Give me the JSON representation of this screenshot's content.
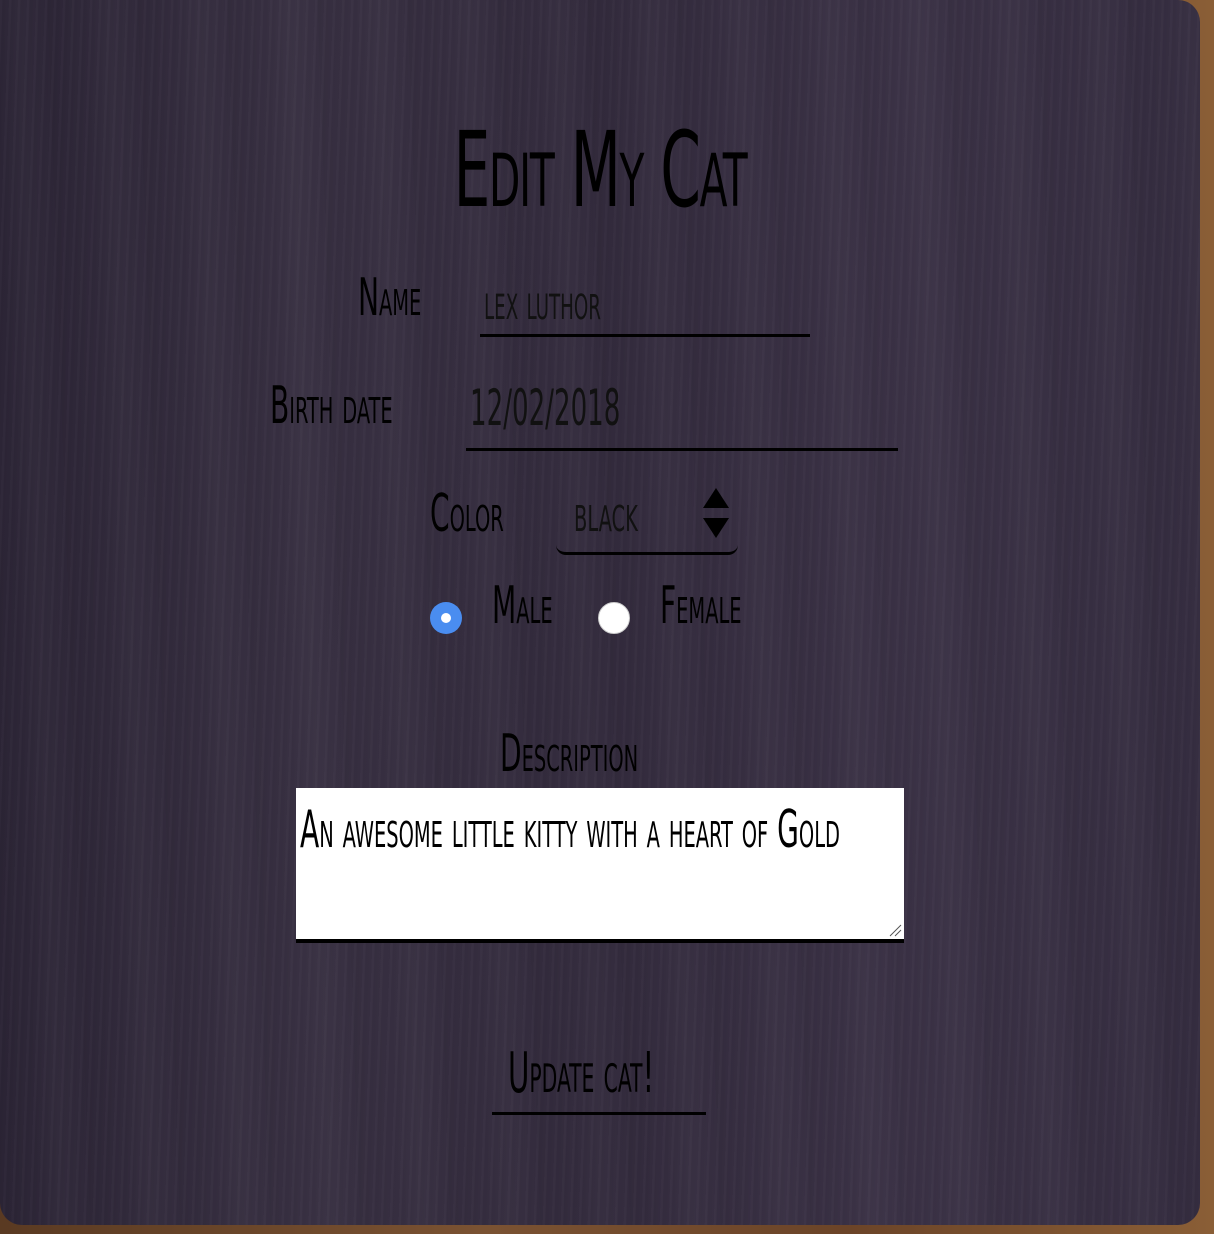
{
  "page": {
    "title": "Edit My Cat"
  },
  "form": {
    "name": {
      "label": "Name",
      "value": "lex luthor"
    },
    "birth_date": {
      "label": "Birth date",
      "value": "12/02/2018"
    },
    "color": {
      "label": "Color",
      "selected": "black"
    },
    "gender": {
      "options": [
        {
          "label": "Male",
          "checked": true
        },
        {
          "label": "Female",
          "checked": false
        }
      ]
    },
    "description": {
      "label": "Description",
      "value": "An awesome little kitty with a heart of Gold"
    },
    "submit_label": "Update cat!"
  },
  "colors": {
    "radio_checked": "#4a8df0",
    "card_background": "#352d40",
    "text": "#000000"
  },
  "icons": {
    "select_arrows": "up-down-arrows-icon",
    "resize_grip": "resize-grip-icon"
  }
}
